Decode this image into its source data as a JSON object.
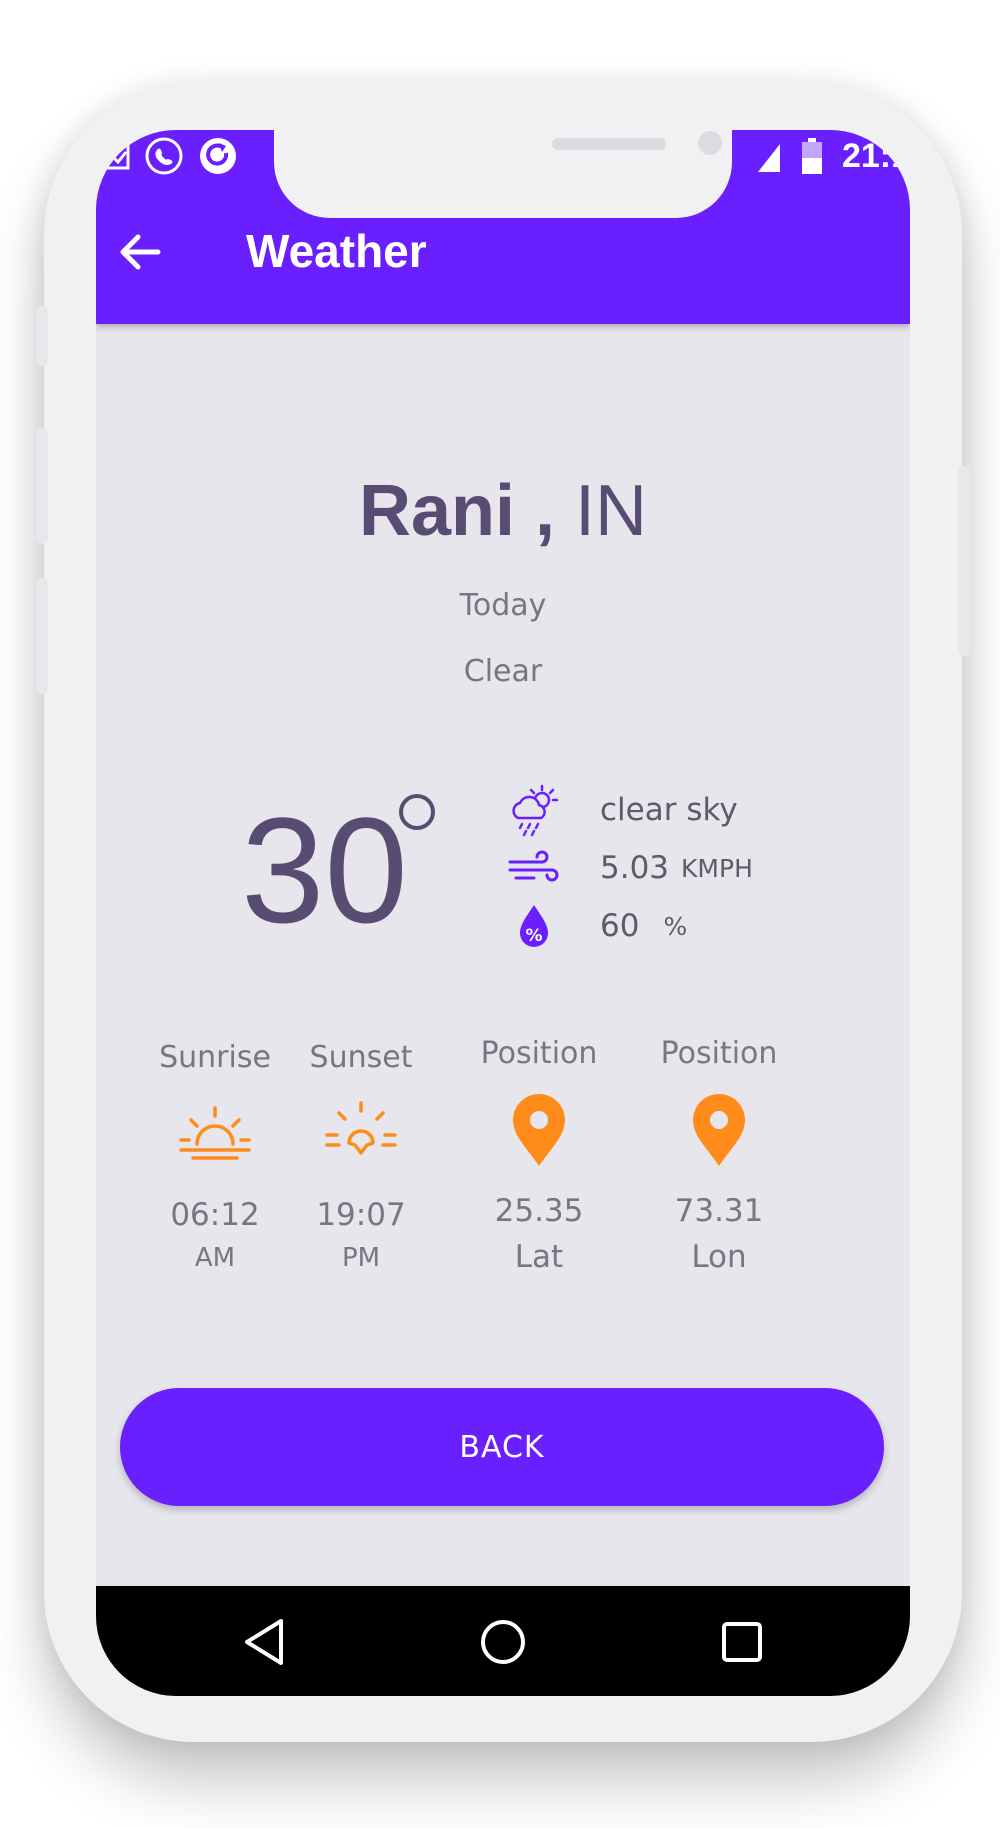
{
  "status_bar": {
    "time": "21:1"
  },
  "app_bar": {
    "title": "Weather"
  },
  "location": {
    "city": "Rani",
    "separator": ",",
    "country": "IN"
  },
  "day": "Today",
  "condition": "Clear",
  "temperature": "30",
  "details": {
    "description": "clear sky",
    "wind_speed": "5.03",
    "wind_unit": "KMPH",
    "humidity": "60",
    "humidity_unit": "%"
  },
  "columns": [
    {
      "label": "Sunrise",
      "value": "06:12",
      "sub": "AM"
    },
    {
      "label": "Sunset",
      "value": "19:07",
      "sub": "PM"
    },
    {
      "label": "Position",
      "value": "25.35",
      "sub": "Lat"
    },
    {
      "label": "Position",
      "value": "73.31",
      "sub": "Lon"
    }
  ],
  "back_button": {
    "label": "BACK"
  },
  "colors": {
    "primary": "#6a1ffe",
    "text": "#594c73",
    "accent": "#ff8c1a",
    "background": "#e7e6ec"
  },
  "icons": {
    "description": "cloud-rain-sun-icon",
    "wind": "wind-icon",
    "humidity": "humidity-drop-icon",
    "sunrise": "sunrise-icon",
    "sunset": "sunset-icon",
    "position": "map-pin-icon"
  }
}
